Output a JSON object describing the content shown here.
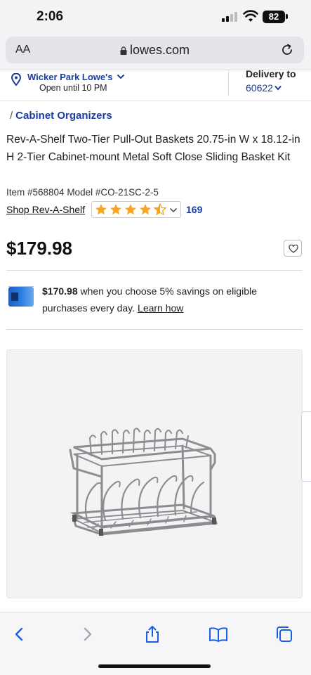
{
  "status": {
    "time": "2:06",
    "battery": "82"
  },
  "browser": {
    "text_size_button": "AA",
    "url": "lowes.com",
    "icons": [
      "lock-icon",
      "reload-icon",
      "back-icon",
      "forward-icon",
      "share-icon",
      "bookmarks-icon",
      "tabs-icon"
    ]
  },
  "store": {
    "name": "Wicker Park Lowe's",
    "hours": "Open until 10 PM",
    "delivery_label": "Delivery to",
    "zip": "60622"
  },
  "breadcrumb": {
    "separator": "/",
    "category": "Cabinet Organizers"
  },
  "product": {
    "title": "Rev-A-Shelf Two-Tier Pull-Out Baskets 20.75-in W x 18.12-in H 2-Tier Cabinet-mount Metal Soft Close Sliding Basket Kit",
    "item_model": "Item #568804 Model #CO-21SC-2-5",
    "brand_link": "Shop Rev-A-Shelf",
    "rating": 4.5,
    "rating_max": 5,
    "review_count": "169",
    "price": "$179.98"
  },
  "savings": {
    "discounted_price": "$170.98",
    "text1": " when you choose 5% savings on eligible",
    "text2": "purchases every day.",
    "learn_link": "Learn how"
  },
  "colors": {
    "link_blue": "#1a3ea0",
    "star_gold": "#f5a623"
  }
}
